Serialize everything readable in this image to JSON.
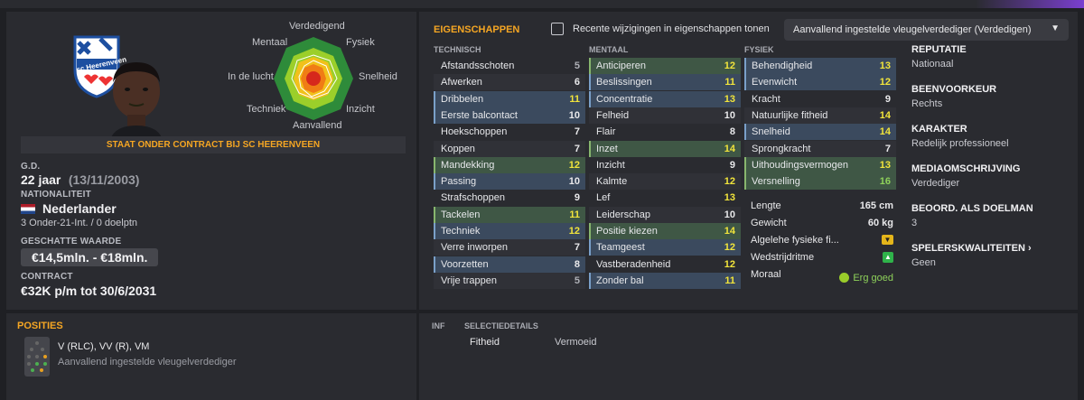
{
  "player": {
    "contract_banner": "STAAT ONDER CONTRACT BIJ SC HEERENVEEN",
    "dob_label": "G.D.",
    "age": "22 jaar",
    "dob": "(13/11/2003)",
    "nationality_label": "NATIONALITEIT",
    "nationality": "Nederlander",
    "caps": "3 Onder-21-Int. / 0 doelptn",
    "value_label": "GESCHATTE WAARDE",
    "value": "€14,5mln. - €18mln.",
    "contract_label": "CONTRACT",
    "contract": "€32K p/m tot 30/6/2031",
    "club_badge_text": "sc Heerenveen"
  },
  "radar": {
    "labels": {
      "top": "Verdedigend",
      "tr": "Fysiek",
      "r": "Snelheid",
      "br": "Inzicht",
      "bottom": "Aanvallend",
      "bl": "Techniek",
      "l": "In de lucht",
      "tl": "Mentaal"
    }
  },
  "attributes": {
    "title": "EIGENSCHAPPEN",
    "recent_changes_label": "Recente wijzigingen in eigenschappen tonen",
    "role_dropdown": "Aanvallend ingestelde vleugelverdediger (Verdedigen)",
    "technical_header": "TECHNISCH",
    "mental_header": "MENTAAL",
    "physical_header": "FYSIEK",
    "technical": [
      {
        "name": "Afstandsschoten",
        "value": "5"
      },
      {
        "name": "Afwerken",
        "value": "6"
      },
      {
        "name": "Dribbelen",
        "value": "11"
      },
      {
        "name": "Eerste balcontact",
        "value": "10"
      },
      {
        "name": "Hoekschoppen",
        "value": "7"
      },
      {
        "name": "Koppen",
        "value": "7"
      },
      {
        "name": "Mandekking",
        "value": "12"
      },
      {
        "name": "Passing",
        "value": "10"
      },
      {
        "name": "Strafschoppen",
        "value": "9"
      },
      {
        "name": "Tackelen",
        "value": "11"
      },
      {
        "name": "Techniek",
        "value": "12"
      },
      {
        "name": "Verre inworpen",
        "value": "7"
      },
      {
        "name": "Voorzetten",
        "value": "8"
      },
      {
        "name": "Vrije trappen",
        "value": "5"
      }
    ],
    "mental": [
      {
        "name": "Anticiperen",
        "value": "12"
      },
      {
        "name": "Beslissingen",
        "value": "11"
      },
      {
        "name": "Concentratie",
        "value": "13"
      },
      {
        "name": "Felheid",
        "value": "10"
      },
      {
        "name": "Flair",
        "value": "8"
      },
      {
        "name": "Inzet",
        "value": "14"
      },
      {
        "name": "Inzicht",
        "value": "9"
      },
      {
        "name": "Kalmte",
        "value": "12"
      },
      {
        "name": "Lef",
        "value": "13"
      },
      {
        "name": "Leiderschap",
        "value": "10"
      },
      {
        "name": "Positie kiezen",
        "value": "14"
      },
      {
        "name": "Teamgeest",
        "value": "12"
      },
      {
        "name": "Vastberadenheid",
        "value": "12"
      },
      {
        "name": "Zonder bal",
        "value": "11"
      }
    ],
    "physical": [
      {
        "name": "Behendigheid",
        "value": "13"
      },
      {
        "name": "Evenwicht",
        "value": "12"
      },
      {
        "name": "Kracht",
        "value": "9"
      },
      {
        "name": "Natuurlijke fitheid",
        "value": "14"
      },
      {
        "name": "Snelheid",
        "value": "14"
      },
      {
        "name": "Sprongkracht",
        "value": "7"
      },
      {
        "name": "Uithoudingsvermogen",
        "value": "13"
      },
      {
        "name": "Versnelling",
        "value": "16"
      }
    ],
    "info": {
      "length_label": "Lengte",
      "length": "165 cm",
      "weight_label": "Gewicht",
      "weight": "60 kg",
      "fitness_label": "Algelehe fysieke fi...",
      "match_label": "Wedstrijdritme",
      "morale_label": "Moraal",
      "morale": "Erg goed"
    }
  },
  "side": {
    "reputation_title": "REPUTATIE",
    "reputation": "Nationaal",
    "foot_title": "BEENVOORKEUR",
    "foot": "Rechts",
    "character_title": "KARAKTER",
    "character": "Redelijk professioneel",
    "media_title": "MEDIAOMSCHRIJVING",
    "media": "Verdediger",
    "gk_title": "BEOORD. ALS DOELMAN",
    "gk": "3",
    "qualities_title": "SPELERSKWALITEITEN",
    "qualities": "Geen"
  },
  "positions": {
    "title": "POSITIES",
    "positions": "V (RLC), VV (R), VM",
    "role": "Aanvallend ingestelde vleugelverdediger"
  },
  "selection": {
    "inf_header": "INF",
    "details_header": "SELECTIEDETAILS",
    "fitness_label": "Fitheid",
    "fitness_value": "Vermoeid"
  },
  "colors": {
    "accent": "#f5a623",
    "yellow": "#f1e43b",
    "green": "#8ed15a",
    "highlight_blue": "#3b4a5e",
    "highlight_green": "#3f5745"
  }
}
